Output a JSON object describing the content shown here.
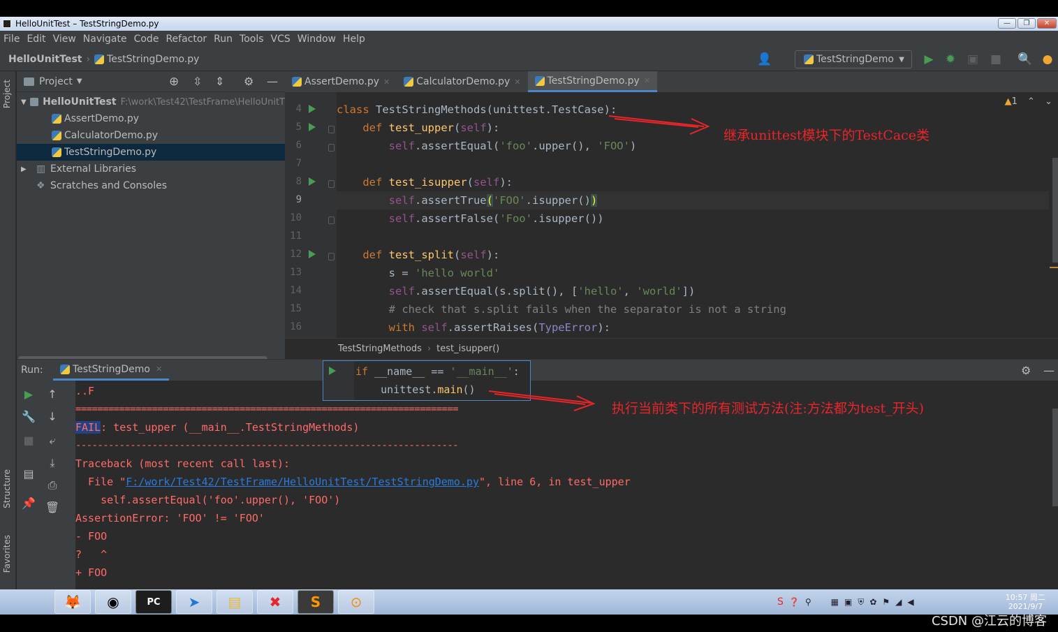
{
  "window": {
    "title": "HelloUnitTest – TestStringDemo.py"
  },
  "menu": [
    "File",
    "Edit",
    "View",
    "Navigate",
    "Code",
    "Refactor",
    "Run",
    "Tools",
    "VCS",
    "Window",
    "Help"
  ],
  "navbar": {
    "project": "HelloUnitTest",
    "file": "TestStringDemo.py",
    "run_config": "TestStringDemo"
  },
  "side_labels": {
    "project": "Project",
    "structure": "Structure",
    "favorites": "Favorites"
  },
  "project_panel": {
    "title": "Project",
    "root": {
      "name": "HelloUnitTest",
      "path": "F:\\work\\Test42\\TestFrame\\HelloUnitT"
    },
    "files": [
      "AssertDemo.py",
      "CalculatorDemo.py",
      "TestStringDemo.py"
    ],
    "external": "External Libraries",
    "scratches": "Scratches and Consoles"
  },
  "editor": {
    "tabs": [
      "AssertDemo.py",
      "CalculatorDemo.py",
      "TestStringDemo.py"
    ],
    "warning_count": "1",
    "line_numbers": [
      "4",
      "5",
      "6",
      "7",
      "8",
      "9",
      "10",
      "11",
      "12",
      "13",
      "14",
      "15",
      "16"
    ],
    "breadcrumb": [
      "TestStringMethods",
      "test_isupper()"
    ]
  },
  "code": {
    "l4": [
      "class",
      "TestStringMethods(unittest.TestCase):"
    ],
    "l5": [
      "def",
      "test_upper",
      "self"
    ],
    "l6": [
      "self",
      ".assertEqual(",
      "'foo'",
      ".upper(), ",
      "'FOO'",
      ")"
    ],
    "l8": [
      "def",
      "test_isupper",
      "self"
    ],
    "l9": [
      "self",
      ".assertTrue",
      "(",
      "'FOO'",
      ".isupper()",
      ")"
    ],
    "l10": [
      "self",
      ".assertFalse(",
      "'Foo'",
      ".isupper())"
    ],
    "l12": [
      "def",
      "test_split",
      "self"
    ],
    "l13": [
      "s = ",
      "'hello world'"
    ],
    "l14": [
      "self",
      ".assertEqual(s.split(), [",
      "'hello'",
      ", ",
      "'world'",
      "])"
    ],
    "l15": "# check that s.split fails when the separator is not a string",
    "l16": [
      "with",
      "self",
      ".assertRaises(",
      "TypeError",
      "):"
    ],
    "popup1": [
      "if",
      " __name__ == ",
      "'__main__'",
      ":"
    ],
    "popup2": [
      "unittest.",
      "main",
      "()"
    ]
  },
  "run": {
    "label": "Run:",
    "tab": "TestStringDemo",
    "console": [
      "..F",
      "======================================================================",
      "FAIL",
      ": test_upper (__main__.TestStringMethods)",
      "----------------------------------------------------------------------",
      "Traceback (most recent call last):",
      "  File \"",
      "F:/work/Test42/TestFrame/HelloUnitTest/TestStringDemo.py",
      "\", line 6, in test_upper",
      "    self.assertEqual('foo'.upper(), 'FOO')",
      "AssertionError: 'FOO' != 'FOO'",
      "- FOO",
      "?   ^",
      "+ FOO"
    ]
  },
  "annotations": {
    "a1": "继承unittest模块下的TestCace类",
    "a2": "执行当前类下的所有测试方法(注:方法都为test_开头)",
    "color": "#e8252a"
  },
  "taskbar": {
    "clock_time": "10:57 周二",
    "clock_date": "2021/9/7"
  },
  "watermark": "CSDN @江云的博客"
}
